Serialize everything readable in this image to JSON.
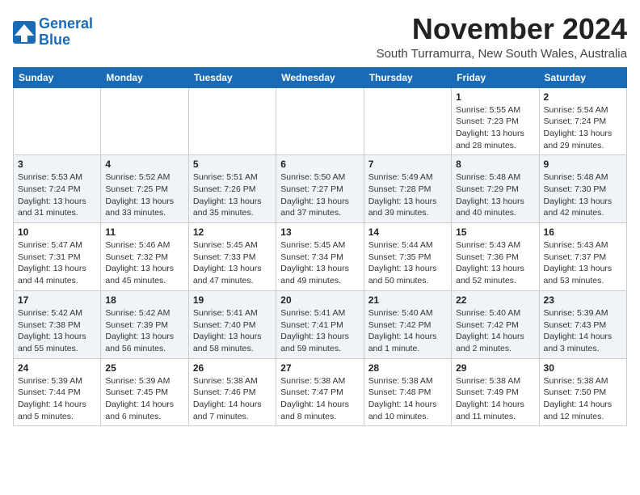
{
  "header": {
    "logo_line1": "General",
    "logo_line2": "Blue",
    "month_title": "November 2024",
    "subtitle": "South Turramurra, New South Wales, Australia"
  },
  "days_of_week": [
    "Sunday",
    "Monday",
    "Tuesday",
    "Wednesday",
    "Thursday",
    "Friday",
    "Saturday"
  ],
  "weeks": [
    [
      {
        "day": "",
        "info": ""
      },
      {
        "day": "",
        "info": ""
      },
      {
        "day": "",
        "info": ""
      },
      {
        "day": "",
        "info": ""
      },
      {
        "day": "",
        "info": ""
      },
      {
        "day": "1",
        "info": "Sunrise: 5:55 AM\nSunset: 7:23 PM\nDaylight: 13 hours and 28 minutes."
      },
      {
        "day": "2",
        "info": "Sunrise: 5:54 AM\nSunset: 7:24 PM\nDaylight: 13 hours and 29 minutes."
      }
    ],
    [
      {
        "day": "3",
        "info": "Sunrise: 5:53 AM\nSunset: 7:24 PM\nDaylight: 13 hours and 31 minutes."
      },
      {
        "day": "4",
        "info": "Sunrise: 5:52 AM\nSunset: 7:25 PM\nDaylight: 13 hours and 33 minutes."
      },
      {
        "day": "5",
        "info": "Sunrise: 5:51 AM\nSunset: 7:26 PM\nDaylight: 13 hours and 35 minutes."
      },
      {
        "day": "6",
        "info": "Sunrise: 5:50 AM\nSunset: 7:27 PM\nDaylight: 13 hours and 37 minutes."
      },
      {
        "day": "7",
        "info": "Sunrise: 5:49 AM\nSunset: 7:28 PM\nDaylight: 13 hours and 39 minutes."
      },
      {
        "day": "8",
        "info": "Sunrise: 5:48 AM\nSunset: 7:29 PM\nDaylight: 13 hours and 40 minutes."
      },
      {
        "day": "9",
        "info": "Sunrise: 5:48 AM\nSunset: 7:30 PM\nDaylight: 13 hours and 42 minutes."
      }
    ],
    [
      {
        "day": "10",
        "info": "Sunrise: 5:47 AM\nSunset: 7:31 PM\nDaylight: 13 hours and 44 minutes."
      },
      {
        "day": "11",
        "info": "Sunrise: 5:46 AM\nSunset: 7:32 PM\nDaylight: 13 hours and 45 minutes."
      },
      {
        "day": "12",
        "info": "Sunrise: 5:45 AM\nSunset: 7:33 PM\nDaylight: 13 hours and 47 minutes."
      },
      {
        "day": "13",
        "info": "Sunrise: 5:45 AM\nSunset: 7:34 PM\nDaylight: 13 hours and 49 minutes."
      },
      {
        "day": "14",
        "info": "Sunrise: 5:44 AM\nSunset: 7:35 PM\nDaylight: 13 hours and 50 minutes."
      },
      {
        "day": "15",
        "info": "Sunrise: 5:43 AM\nSunset: 7:36 PM\nDaylight: 13 hours and 52 minutes."
      },
      {
        "day": "16",
        "info": "Sunrise: 5:43 AM\nSunset: 7:37 PM\nDaylight: 13 hours and 53 minutes."
      }
    ],
    [
      {
        "day": "17",
        "info": "Sunrise: 5:42 AM\nSunset: 7:38 PM\nDaylight: 13 hours and 55 minutes."
      },
      {
        "day": "18",
        "info": "Sunrise: 5:42 AM\nSunset: 7:39 PM\nDaylight: 13 hours and 56 minutes."
      },
      {
        "day": "19",
        "info": "Sunrise: 5:41 AM\nSunset: 7:40 PM\nDaylight: 13 hours and 58 minutes."
      },
      {
        "day": "20",
        "info": "Sunrise: 5:41 AM\nSunset: 7:41 PM\nDaylight: 13 hours and 59 minutes."
      },
      {
        "day": "21",
        "info": "Sunrise: 5:40 AM\nSunset: 7:42 PM\nDaylight: 14 hours and 1 minute."
      },
      {
        "day": "22",
        "info": "Sunrise: 5:40 AM\nSunset: 7:42 PM\nDaylight: 14 hours and 2 minutes."
      },
      {
        "day": "23",
        "info": "Sunrise: 5:39 AM\nSunset: 7:43 PM\nDaylight: 14 hours and 3 minutes."
      }
    ],
    [
      {
        "day": "24",
        "info": "Sunrise: 5:39 AM\nSunset: 7:44 PM\nDaylight: 14 hours and 5 minutes."
      },
      {
        "day": "25",
        "info": "Sunrise: 5:39 AM\nSunset: 7:45 PM\nDaylight: 14 hours and 6 minutes."
      },
      {
        "day": "26",
        "info": "Sunrise: 5:38 AM\nSunset: 7:46 PM\nDaylight: 14 hours and 7 minutes."
      },
      {
        "day": "27",
        "info": "Sunrise: 5:38 AM\nSunset: 7:47 PM\nDaylight: 14 hours and 8 minutes."
      },
      {
        "day": "28",
        "info": "Sunrise: 5:38 AM\nSunset: 7:48 PM\nDaylight: 14 hours and 10 minutes."
      },
      {
        "day": "29",
        "info": "Sunrise: 5:38 AM\nSunset: 7:49 PM\nDaylight: 14 hours and 11 minutes."
      },
      {
        "day": "30",
        "info": "Sunrise: 5:38 AM\nSunset: 7:50 PM\nDaylight: 14 hours and 12 minutes."
      }
    ]
  ]
}
